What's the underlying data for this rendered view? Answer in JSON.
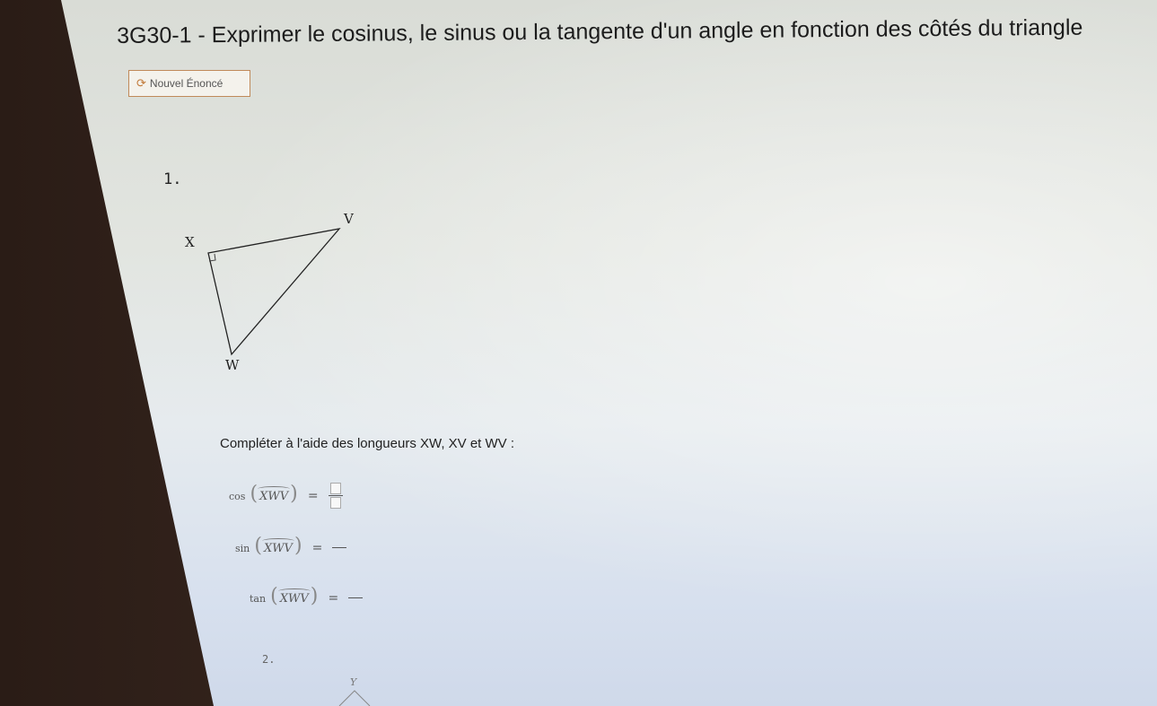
{
  "page": {
    "title": "3G30-1 - Exprimer le cosinus, le sinus ou la tangente d'un angle en fonction des côtés du triangle",
    "new_button": {
      "icon": "refresh-icon",
      "label": "Nouvel Énoncé"
    }
  },
  "exercise1": {
    "number": "1.",
    "vertices": {
      "v": "V",
      "x": "X",
      "w": "W"
    },
    "instruction": "Compléter à l'aide des longueurs XW, XV et WV :",
    "equations": [
      {
        "fn": "cos",
        "angle": "XWV",
        "equals": "="
      },
      {
        "fn": "sin",
        "angle": "XWV",
        "equals": "="
      },
      {
        "fn": "tan",
        "angle": "XWV",
        "equals": "="
      }
    ]
  },
  "exercise2": {
    "number": "2.",
    "vertex_top": "Y"
  }
}
